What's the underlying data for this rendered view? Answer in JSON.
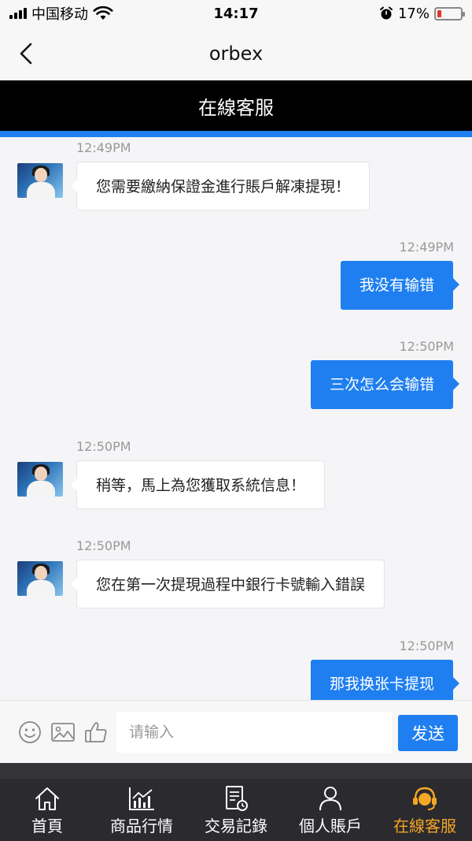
{
  "status_bar": {
    "carrier": "中国移动",
    "time": "14:17",
    "battery_percent": "17%",
    "battery_level": 0.17
  },
  "nav": {
    "title": "orbex"
  },
  "header": {
    "title": "在線客服"
  },
  "messages": [
    {
      "side": "in",
      "time": "12:49PM",
      "text": "您需要繳納保證金進行賬戶解凍提現！"
    },
    {
      "side": "out",
      "time": "12:49PM",
      "text": "我没有输错"
    },
    {
      "side": "out",
      "time": "12:50PM",
      "text": "三次怎么会输错"
    },
    {
      "side": "in",
      "time": "12:50PM",
      "text": "稍等，馬上為您獲取系統信息！"
    },
    {
      "side": "in",
      "time": "12:50PM",
      "text": "您在第一次提現過程中銀行卡號輸入錯誤"
    },
    {
      "side": "out",
      "time": "12:50PM",
      "text": "那我换张卡提现"
    }
  ],
  "input": {
    "placeholder": "请输入",
    "send_label": "发送"
  },
  "tabs": [
    {
      "label": "首頁",
      "icon": "home-icon"
    },
    {
      "label": "商品行情",
      "icon": "chart-icon"
    },
    {
      "label": "交易記錄",
      "icon": "document-icon"
    },
    {
      "label": "個人賬戶",
      "icon": "user-icon"
    },
    {
      "label": "在線客服",
      "icon": "headset-icon",
      "active": true
    }
  ],
  "colors": {
    "accent_blue": "#1f7ff0",
    "active_tab": "#f5a623",
    "tab_bar_bg": "#2b2b2f",
    "header_bg": "#000000"
  }
}
